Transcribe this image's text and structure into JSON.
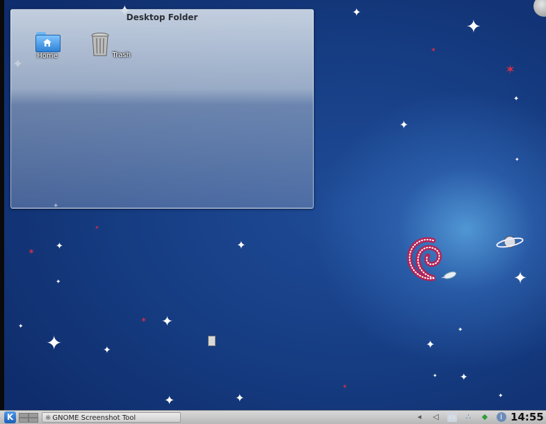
{
  "folder": {
    "title": "Desktop Folder",
    "icons": [
      {
        "label": "Home",
        "icon": "home-folder-icon"
      },
      {
        "label": "Trash",
        "icon": "trash-icon"
      }
    ]
  },
  "taskbar": {
    "kmenu_icon": "kde-menu-icon",
    "pager_icon": "virtual-desktop-pager",
    "task_label": "GNOME Screenshot Tool",
    "tray_icons": [
      "volume-icon",
      "speaker-icon",
      "clipboard-icon",
      "network-icon",
      "update-notifier-icon",
      "info-icon"
    ],
    "clock": "14:55"
  },
  "colors": {
    "desktop_bg": "#173f86",
    "taskbar_bg": "#c8c8c8"
  }
}
